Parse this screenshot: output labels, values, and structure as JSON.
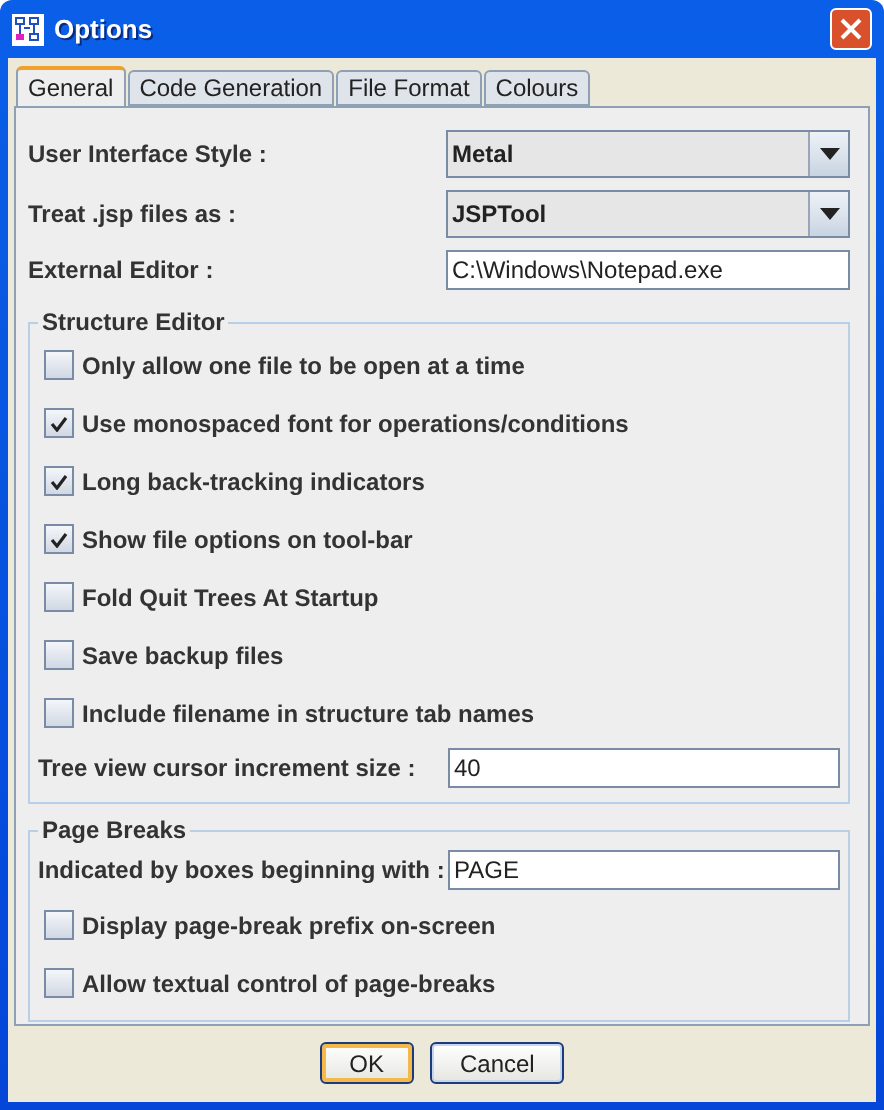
{
  "window": {
    "title": "Options"
  },
  "tabs": [
    {
      "label": "General",
      "selected": true
    },
    {
      "label": "Code Generation",
      "selected": false
    },
    {
      "label": "File Format",
      "selected": false
    },
    {
      "label": "Colours",
      "selected": false
    }
  ],
  "fields": [
    {
      "kind": "combo",
      "label": "User Interface Style :",
      "value": "Metal"
    },
    {
      "kind": "combo",
      "label": "Treat .jsp files as :",
      "value": "JSPTool"
    },
    {
      "kind": "text",
      "label": "External Editor :",
      "value": "C:\\Windows\\Notepad.exe"
    }
  ],
  "groups": [
    {
      "title": "Structure Editor",
      "items": [
        {
          "kind": "check",
          "label": "Only allow one file to be open at a time",
          "checked": false
        },
        {
          "kind": "check",
          "label": "Use monospaced font for operations/conditions",
          "checked": true
        },
        {
          "kind": "check",
          "label": "Long back-tracking indicators",
          "checked": true
        },
        {
          "kind": "check",
          "label": "Show file options on tool-bar",
          "checked": true
        },
        {
          "kind": "check",
          "label": "Fold Quit Trees At Startup",
          "checked": false
        },
        {
          "kind": "check",
          "label": "Save backup files",
          "checked": false
        },
        {
          "kind": "check",
          "label": "Include filename in structure tab names",
          "checked": false
        },
        {
          "kind": "text",
          "label": "Tree view cursor increment size :",
          "value": "40"
        }
      ]
    },
    {
      "title": "Page Breaks",
      "items": [
        {
          "kind": "text",
          "label": "Indicated by boxes beginning with :",
          "value": "PAGE"
        },
        {
          "kind": "check",
          "label": "Display page-break prefix on-screen",
          "checked": false
        },
        {
          "kind": "check",
          "label": "Allow textual control of page-breaks",
          "checked": false
        }
      ]
    }
  ],
  "buttons": [
    {
      "label": "OK",
      "default": true
    },
    {
      "label": "Cancel",
      "default": false
    }
  ]
}
